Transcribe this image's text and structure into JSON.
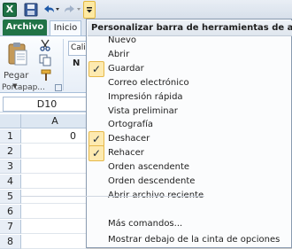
{
  "qat": {
    "app_icon_letter": "X",
    "buttons": [
      {
        "name": "save",
        "icon": "save-icon"
      },
      {
        "name": "undo",
        "icon": "undo-icon"
      },
      {
        "name": "redo",
        "icon": "redo-icon"
      },
      {
        "name": "customize",
        "icon": "customize-qat-icon"
      }
    ]
  },
  "ribbon": {
    "tab_file": "Archivo",
    "tab_home": "Inicio",
    "paste_label": "Pegar",
    "font_name": "Calib",
    "bold_label": "N",
    "clipboard_group": "Portapap..."
  },
  "namebox": {
    "value": "D10"
  },
  "grid": {
    "column_header": "A",
    "rows": [
      {
        "num": "1",
        "a": "0"
      },
      {
        "num": "2",
        "a": ""
      },
      {
        "num": "3",
        "a": ""
      },
      {
        "num": "4",
        "a": ""
      },
      {
        "num": "5",
        "a": ""
      },
      {
        "num": "6",
        "a": ""
      },
      {
        "num": "7",
        "a": ""
      },
      {
        "num": "8",
        "a": ""
      }
    ]
  },
  "menu": {
    "title": "Personalizar barra de herramientas de acceso rápido",
    "items": [
      {
        "label": "Nuevo",
        "checked": false
      },
      {
        "label": "Abrir",
        "checked": false
      },
      {
        "label": "Guardar",
        "checked": true
      },
      {
        "label": "Correo electrónico",
        "checked": false
      },
      {
        "label": "Impresión rápida",
        "checked": false
      },
      {
        "label": "Vista preliminar",
        "checked": false
      },
      {
        "label": "Ortografía",
        "checked": false
      },
      {
        "label": "Deshacer",
        "checked": true
      },
      {
        "label": "Rehacer",
        "checked": true
      },
      {
        "label": "Orden ascendente",
        "checked": false
      },
      {
        "label": "Orden descendente",
        "checked": false
      },
      {
        "label": "Abrir archivo reciente",
        "checked": false
      }
    ],
    "more_commands": "Más comandos...",
    "show_below": "Mostrar debajo de la cinta de opciones",
    "check_glyph": "✓",
    "accent_check_bg": "#fdeab0"
  }
}
